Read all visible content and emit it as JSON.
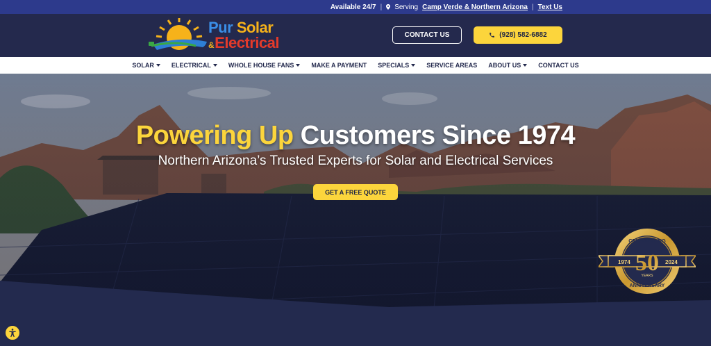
{
  "topbar": {
    "availability": "Available 24/7",
    "serving_prefix": "Serving",
    "serving_area": "Camp Verde & Northern Arizona",
    "text_us": "Text Us"
  },
  "logo": {
    "word1_a": "Pur",
    "word1_b": "Solar",
    "amp": "&",
    "word2": "Electrical"
  },
  "header": {
    "contact_label": "CONTACT US",
    "phone_label": "(928) 582-6882"
  },
  "nav": {
    "items": [
      {
        "label": "SOLAR",
        "dropdown": true
      },
      {
        "label": "ELECTRICAL",
        "dropdown": true
      },
      {
        "label": "WHOLE HOUSE FANS",
        "dropdown": true
      },
      {
        "label": "MAKE A PAYMENT",
        "dropdown": false
      },
      {
        "label": "SPECIALS",
        "dropdown": true
      },
      {
        "label": "SERVICE AREAS",
        "dropdown": false
      },
      {
        "label": "ABOUT US",
        "dropdown": true
      },
      {
        "label": "CONTACT US",
        "dropdown": false
      }
    ]
  },
  "hero": {
    "title_highlight": "Powering Up",
    "title_rest": "Customers Since 1974",
    "subtitle": "Northern Arizona’s Trusted Experts for Solar and Electrical Services",
    "cta": "GET A FREE QUOTE"
  },
  "badge": {
    "top": "CELEBRATING",
    "number": "50",
    "years": "YEARS",
    "bottom": "ANNIVERSARY",
    "start_year": "1974",
    "end_year": "2024"
  },
  "colors": {
    "navy": "#24294d",
    "topbar_blue": "#2d3a8c",
    "accent_yellow": "#fcd53c"
  }
}
